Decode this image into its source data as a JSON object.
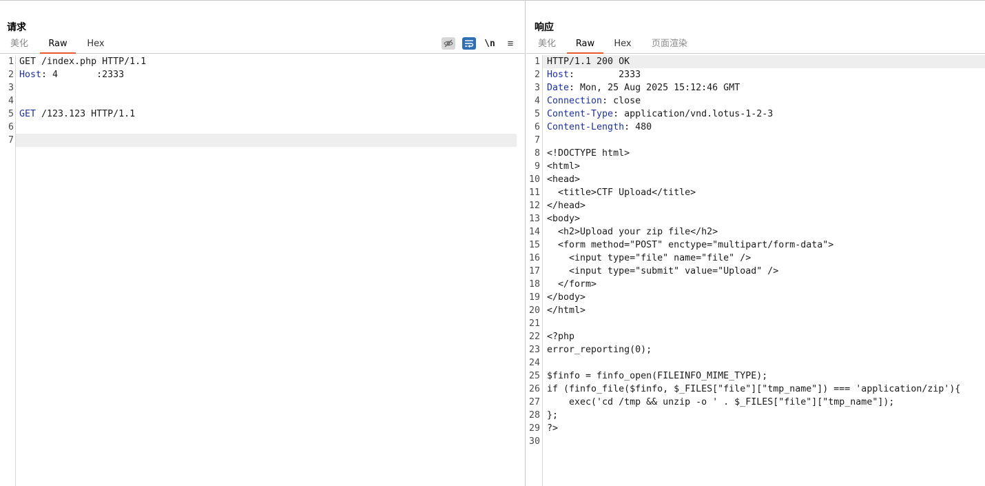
{
  "request": {
    "title": "请求",
    "tabs": [
      {
        "label": "美化"
      },
      {
        "label": "Raw"
      },
      {
        "label": "Hex"
      }
    ],
    "toolbar": {
      "eye_icon": "eye-off-icon",
      "wrap_icon": "word-wrap-icon",
      "newline_label": "\\n",
      "menu_icon": "hamburger-menu-icon"
    },
    "lines": [
      {
        "n": "1",
        "key": "",
        "rest": "GET /index.php HTTP/1.1"
      },
      {
        "n": "2",
        "key": "Host",
        "rest": ": 4       :2333"
      },
      {
        "n": "3",
        "key": "",
        "rest": ""
      },
      {
        "n": "4",
        "key": "",
        "rest": ""
      },
      {
        "n": "5",
        "key": "GET",
        "rest": " /123.123 HTTP/1.1"
      },
      {
        "n": "6",
        "key": "",
        "rest": ""
      },
      {
        "n": "7",
        "key": "",
        "rest": ""
      }
    ]
  },
  "response": {
    "title": "响应",
    "tabs": [
      {
        "label": "美化"
      },
      {
        "label": "Raw"
      },
      {
        "label": "Hex"
      },
      {
        "label": "页面渲染"
      }
    ],
    "lines": [
      {
        "n": "1",
        "key": "",
        "rest": "HTTP/1.1 200 OK"
      },
      {
        "n": "2",
        "key": "Host",
        "rest": ":        2333"
      },
      {
        "n": "3",
        "key": "Date",
        "rest": ": Mon, 25 Aug 2025 15:12:46 GMT"
      },
      {
        "n": "4",
        "key": "Connection",
        "rest": ": close"
      },
      {
        "n": "5",
        "key": "Content-Type",
        "rest": ": application/vnd.lotus-1-2-3"
      },
      {
        "n": "6",
        "key": "Content-Length",
        "rest": ": 480"
      },
      {
        "n": "7",
        "key": "",
        "rest": ""
      },
      {
        "n": "8",
        "key": "",
        "rest": "<!DOCTYPE html>"
      },
      {
        "n": "9",
        "key": "",
        "rest": "<html>"
      },
      {
        "n": "10",
        "key": "",
        "rest": "<head>"
      },
      {
        "n": "11",
        "key": "",
        "rest": "  <title>CTF Upload</title>"
      },
      {
        "n": "12",
        "key": "",
        "rest": "</head>"
      },
      {
        "n": "13",
        "key": "",
        "rest": "<body>"
      },
      {
        "n": "14",
        "key": "",
        "rest": "  <h2>Upload your zip file</h2>"
      },
      {
        "n": "15",
        "key": "",
        "rest": "  <form method=\"POST\" enctype=\"multipart/form-data\">"
      },
      {
        "n": "16",
        "key": "",
        "rest": "    <input type=\"file\" name=\"file\" />"
      },
      {
        "n": "17",
        "key": "",
        "rest": "    <input type=\"submit\" value=\"Upload\" />"
      },
      {
        "n": "18",
        "key": "",
        "rest": "  </form>"
      },
      {
        "n": "19",
        "key": "",
        "rest": "</body>"
      },
      {
        "n": "20",
        "key": "",
        "rest": "</html>"
      },
      {
        "n": "21",
        "key": "",
        "rest": ""
      },
      {
        "n": "22",
        "key": "",
        "rest": "<?php"
      },
      {
        "n": "23",
        "key": "",
        "rest": "error_reporting(0);"
      },
      {
        "n": "24",
        "key": "",
        "rest": ""
      },
      {
        "n": "25",
        "key": "",
        "rest": "$finfo = finfo_open(FILEINFO_MIME_TYPE);"
      },
      {
        "n": "26",
        "key": "",
        "rest": "if (finfo_file($finfo, $_FILES[\"file\"][\"tmp_name\"]) === 'application/zip'){"
      },
      {
        "n": "27",
        "key": "",
        "rest": "    exec('cd /tmp && unzip -o ' . $_FILES[\"file\"][\"tmp_name\"]);"
      },
      {
        "n": "28",
        "key": "",
        "rest": "};"
      },
      {
        "n": "29",
        "key": "",
        "rest": "?>"
      },
      {
        "n": "30",
        "key": "",
        "rest": ""
      }
    ]
  },
  "colors": {
    "accent_tab_underline": "#e8582a",
    "header_key": "#1b2fa8",
    "wrap_button": "#2f6fb3"
  }
}
